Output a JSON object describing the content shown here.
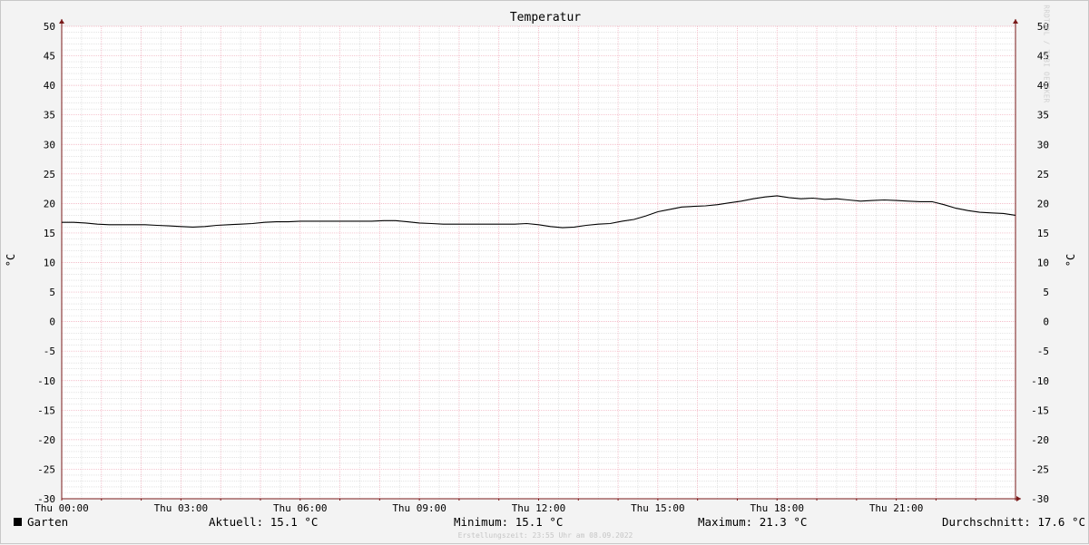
{
  "chart_data": {
    "type": "line",
    "title": "Temperatur",
    "ylabel": "°C",
    "ylim": [
      -30,
      50
    ],
    "yticks": [
      "50",
      "45",
      "40",
      "35",
      "30",
      "25",
      "20",
      "15",
      "10",
      "5",
      "0",
      "-5",
      "-10",
      "-15",
      "-20",
      "-25",
      "-30"
    ],
    "x_range_hours": [
      0,
      24
    ],
    "xticks": [
      "Thu 00:00",
      "Thu 03:00",
      "Thu 06:00",
      "Thu 09:00",
      "Thu 12:00",
      "Thu 15:00",
      "Thu 18:00",
      "Thu 21:00"
    ],
    "grid": true,
    "legend_placement": "bottom",
    "series": [
      {
        "name": "Garten",
        "color": "#000000",
        "x": [
          0,
          0.3,
          0.6,
          0.9,
          1.2,
          1.5,
          1.8,
          2.1,
          2.4,
          2.7,
          3.0,
          3.3,
          3.6,
          3.9,
          4.2,
          4.5,
          4.8,
          5.1,
          5.4,
          5.7,
          6.0,
          6.3,
          6.6,
          6.9,
          7.2,
          7.5,
          7.8,
          8.1,
          8.4,
          8.7,
          9.0,
          9.3,
          9.6,
          9.9,
          10.2,
          10.5,
          10.8,
          11.1,
          11.4,
          11.7,
          12.0,
          12.3,
          12.6,
          12.9,
          13.2,
          13.5,
          13.8,
          14.1,
          14.4,
          14.7,
          15.0,
          15.3,
          15.6,
          15.9,
          16.2,
          16.5,
          16.8,
          17.1,
          17.4,
          17.7,
          18.0,
          18.3,
          18.6,
          18.9,
          19.2,
          19.5,
          19.8,
          20.1,
          20.4,
          20.7,
          21.0,
          21.3,
          21.6,
          21.9,
          22.2,
          22.5,
          22.8,
          23.1,
          23.4,
          23.7,
          24.0
        ],
        "values": [
          16.8,
          16.8,
          16.7,
          16.5,
          16.4,
          16.4,
          16.4,
          16.4,
          16.3,
          16.2,
          16.1,
          16.0,
          16.1,
          16.3,
          16.4,
          16.5,
          16.6,
          16.8,
          16.9,
          16.9,
          17.0,
          17.0,
          17.0,
          17.0,
          17.0,
          17.0,
          17.0,
          17.1,
          17.1,
          16.9,
          16.7,
          16.6,
          16.5,
          16.5,
          16.5,
          16.5,
          16.5,
          16.5,
          16.5,
          16.6,
          16.4,
          16.1,
          15.9,
          16.0,
          16.3,
          16.5,
          16.6,
          17.0,
          17.3,
          17.9,
          18.6,
          19.0,
          19.4,
          19.5,
          19.6,
          19.8,
          20.1,
          20.4,
          20.8,
          21.1,
          21.3,
          21.0,
          20.8,
          20.9,
          20.7,
          20.8,
          20.6,
          20.4,
          20.5,
          20.6,
          20.5,
          20.4,
          20.3,
          20.3,
          19.8,
          19.2,
          18.8,
          18.5,
          18.4,
          18.3,
          18.0
        ]
      }
    ]
  },
  "legend": {
    "series_name": "Garten",
    "current": "Aktuell: 15.1 °C",
    "minimum": "Minimum: 15.1 °C",
    "maximum": "Maximum: 21.3 °C",
    "average": "Durchschnitt: 17.6 °C"
  },
  "footer": "Erstellungszeit: 23:55 Uhr am 08.09.2022",
  "credit": "RRDTOOL / TOBI OETIKER",
  "colors": {
    "minor_grid": "#d3d3d3",
    "major_grid": "#f0a8b8",
    "axis": "#7a1a1a",
    "line": "#000000",
    "plot_bg": "#ffffff",
    "canvas_bg": "#f3f3f3"
  }
}
